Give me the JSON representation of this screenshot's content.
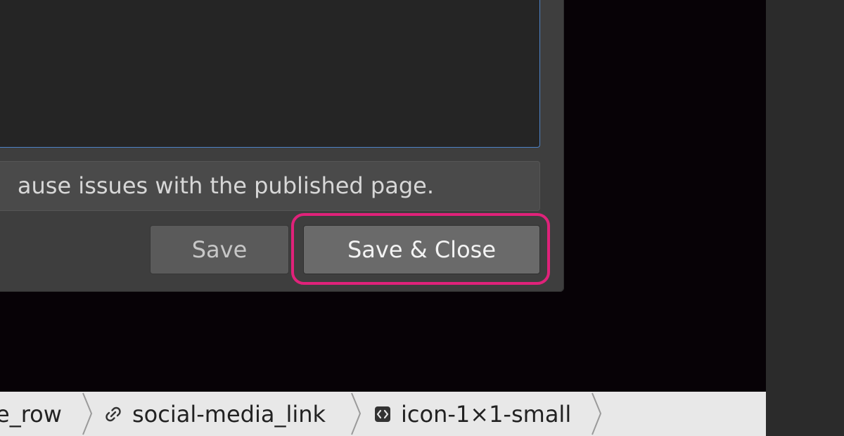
{
  "editor": {
    "warning_text": "ause issues with the published page.",
    "save_label": "Save",
    "save_close_label": "Save & Close"
  },
  "breadcrumb": {
    "items": [
      {
        "label": "e_row",
        "icon": "none"
      },
      {
        "label": "social-media_link",
        "icon": "link-icon"
      },
      {
        "label": "icon-1×1-small",
        "icon": "code-embed-icon"
      }
    ]
  },
  "colors": {
    "accent_focus": "#e0227a",
    "code_border": "#4d82c7",
    "modal_bg": "#3e3e3e",
    "canvas_bg": "#070206"
  }
}
